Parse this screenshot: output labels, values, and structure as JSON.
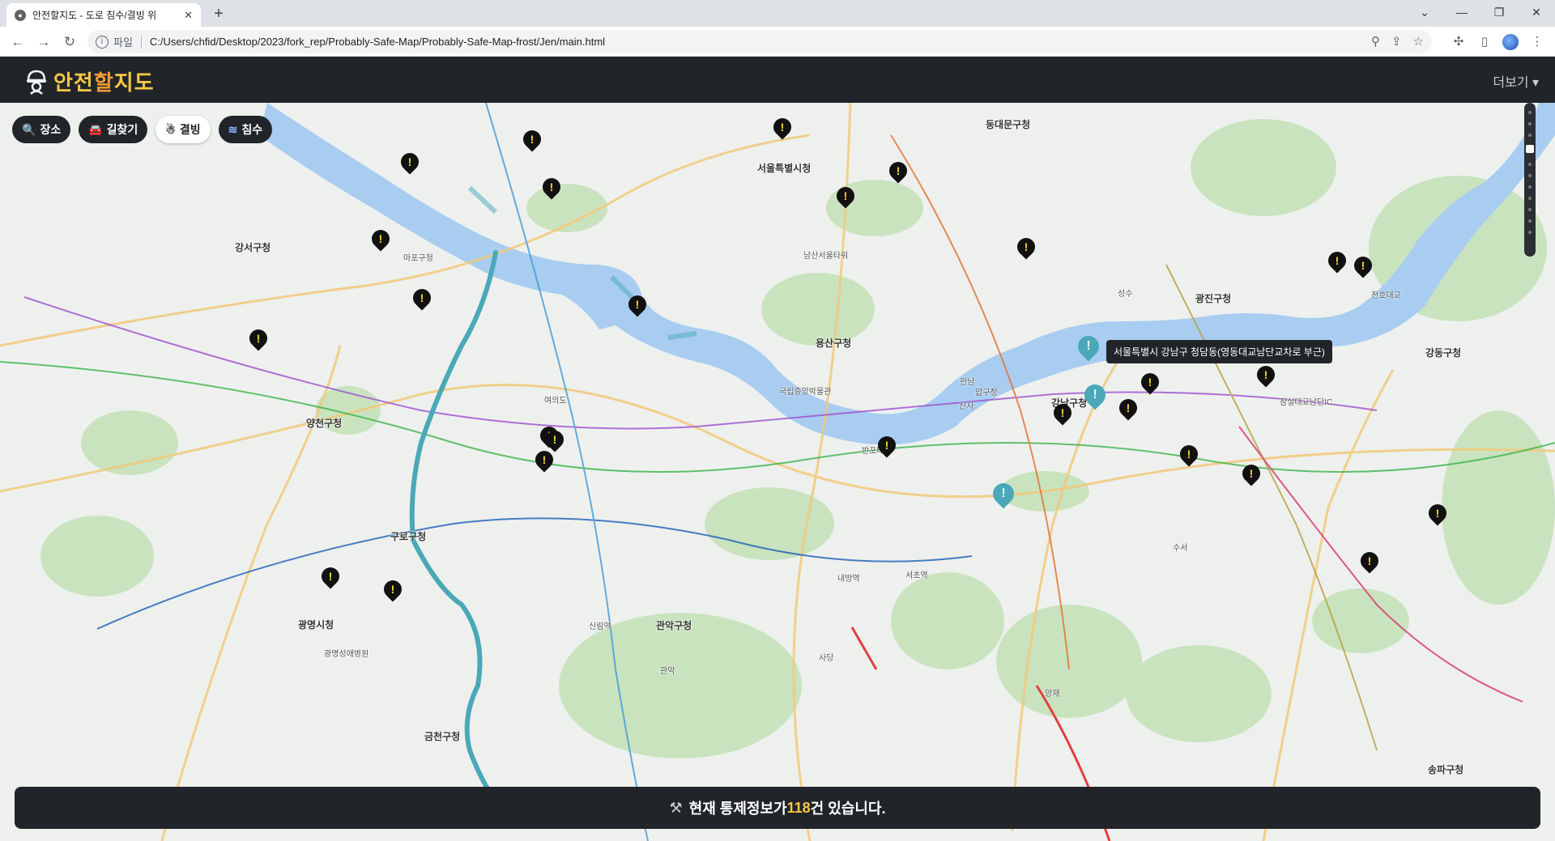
{
  "browser": {
    "tab_title": "안전할지도 - 도로 침수/결빙 위",
    "address_scheme": "파일",
    "address_url": "C:/Users/chfid/Desktop/2023/fork_rep/Probably-Safe-Map/Probably-Safe-Map-frost/Jen/main.html"
  },
  "app": {
    "logo": {
      "part1": "안전",
      "part2": "할",
      "part3": "지도"
    },
    "more_label": "더보기 ▾"
  },
  "filters": [
    {
      "label": "장소",
      "icon": "search-icon"
    },
    {
      "label": "길찾기",
      "icon": "car-icon"
    },
    {
      "label": "결빙",
      "icon": "snowman-icon"
    },
    {
      "label": "침수",
      "icon": "flood-icon"
    }
  ],
  "tooltip": "서울특별시 강남구 청담동(영동대교남단교차로 부근)",
  "status": {
    "prefix": "현재 통제정보가 ",
    "count": "118",
    "suffix": "건 있습니다."
  },
  "map_labels": {
    "gangseo": "강서구청",
    "yangcheon": "양천구청",
    "guro": "구로구청",
    "geumcheon": "금천구청",
    "gwangmyeong": "광명시청",
    "gwanak": "관악구청",
    "yongsan": "용산구청",
    "gangnam": "강남구청",
    "gwangjin": "광진구청",
    "gangdong": "강동구청",
    "songpa": "송파구청",
    "seoulcity": "서울특별시청",
    "dongdaemun": "동대문구청",
    "suseo": "수서",
    "bangbae": "반포대교",
    "yeouido": "여의도",
    "mapo": "마포구청",
    "jamsil": "잠실대교남단IC",
    "cheonho": "천호대교",
    "yangjae": "양재",
    "sinsa": "신사",
    "apgujeong": "압구정",
    "seongsu": "성수",
    "hannam": "한남",
    "namsan": "남산서울타워",
    "national_museum": "국립중앙박물관",
    "gwangmyeong2": "광명성애병원",
    "sillim": "신림역",
    "gwanak2": "관악",
    "sadang": "사당",
    "naebang": "내방역",
    "seocho": "서초역"
  },
  "colors": {
    "flood_marker": "#4aa8b8",
    "ice_marker": "#111111",
    "highlight": "#f6c744",
    "water": "#a8cdf1",
    "route": "#4aa8b8"
  }
}
